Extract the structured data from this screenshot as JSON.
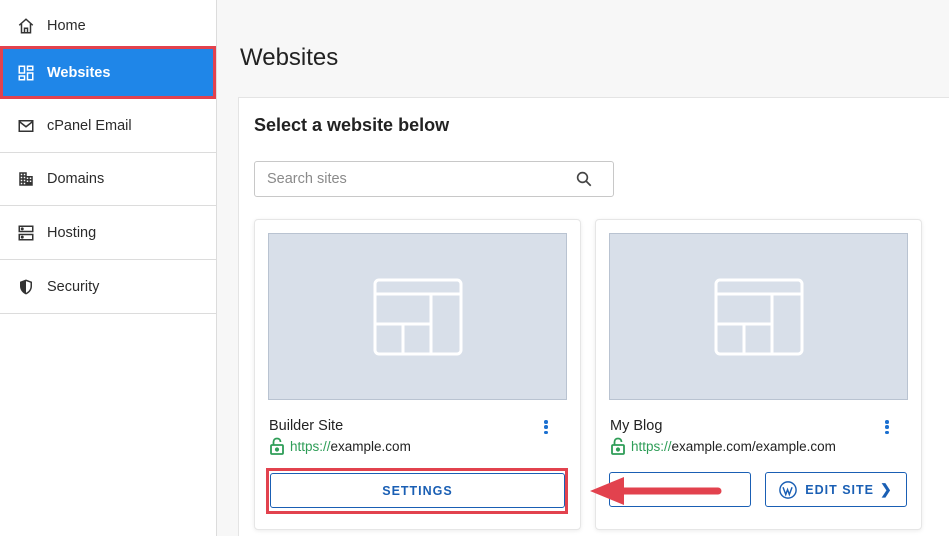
{
  "sidebar": {
    "items": [
      {
        "label": "Home",
        "icon": "home-icon"
      },
      {
        "label": "Websites",
        "icon": "websites-icon",
        "active": true
      },
      {
        "label": "cPanel Email",
        "icon": "mail-icon"
      },
      {
        "label": "Domains",
        "icon": "domains-icon"
      },
      {
        "label": "Hosting",
        "icon": "server-icon"
      },
      {
        "label": "Security",
        "icon": "shield-icon"
      }
    ]
  },
  "main": {
    "title": "Websites",
    "panel_title": "Select a website below",
    "search": {
      "placeholder": "Search sites",
      "value": ""
    }
  },
  "sites": [
    {
      "name": "Builder Site",
      "url_protocol": "https://",
      "url_host": "example.com",
      "settings_label": "SETTINGS"
    },
    {
      "name": "My Blog",
      "url_protocol": "https://",
      "url_host": "example.com/example.com",
      "edit_label": "EDIT SITE"
    }
  ],
  "colors": {
    "accent": "#1f86e8",
    "link": "#1a5fb4",
    "highlight": "#e2424e",
    "secure": "#2e9d57",
    "thumbnail": "#d8dfe9"
  }
}
